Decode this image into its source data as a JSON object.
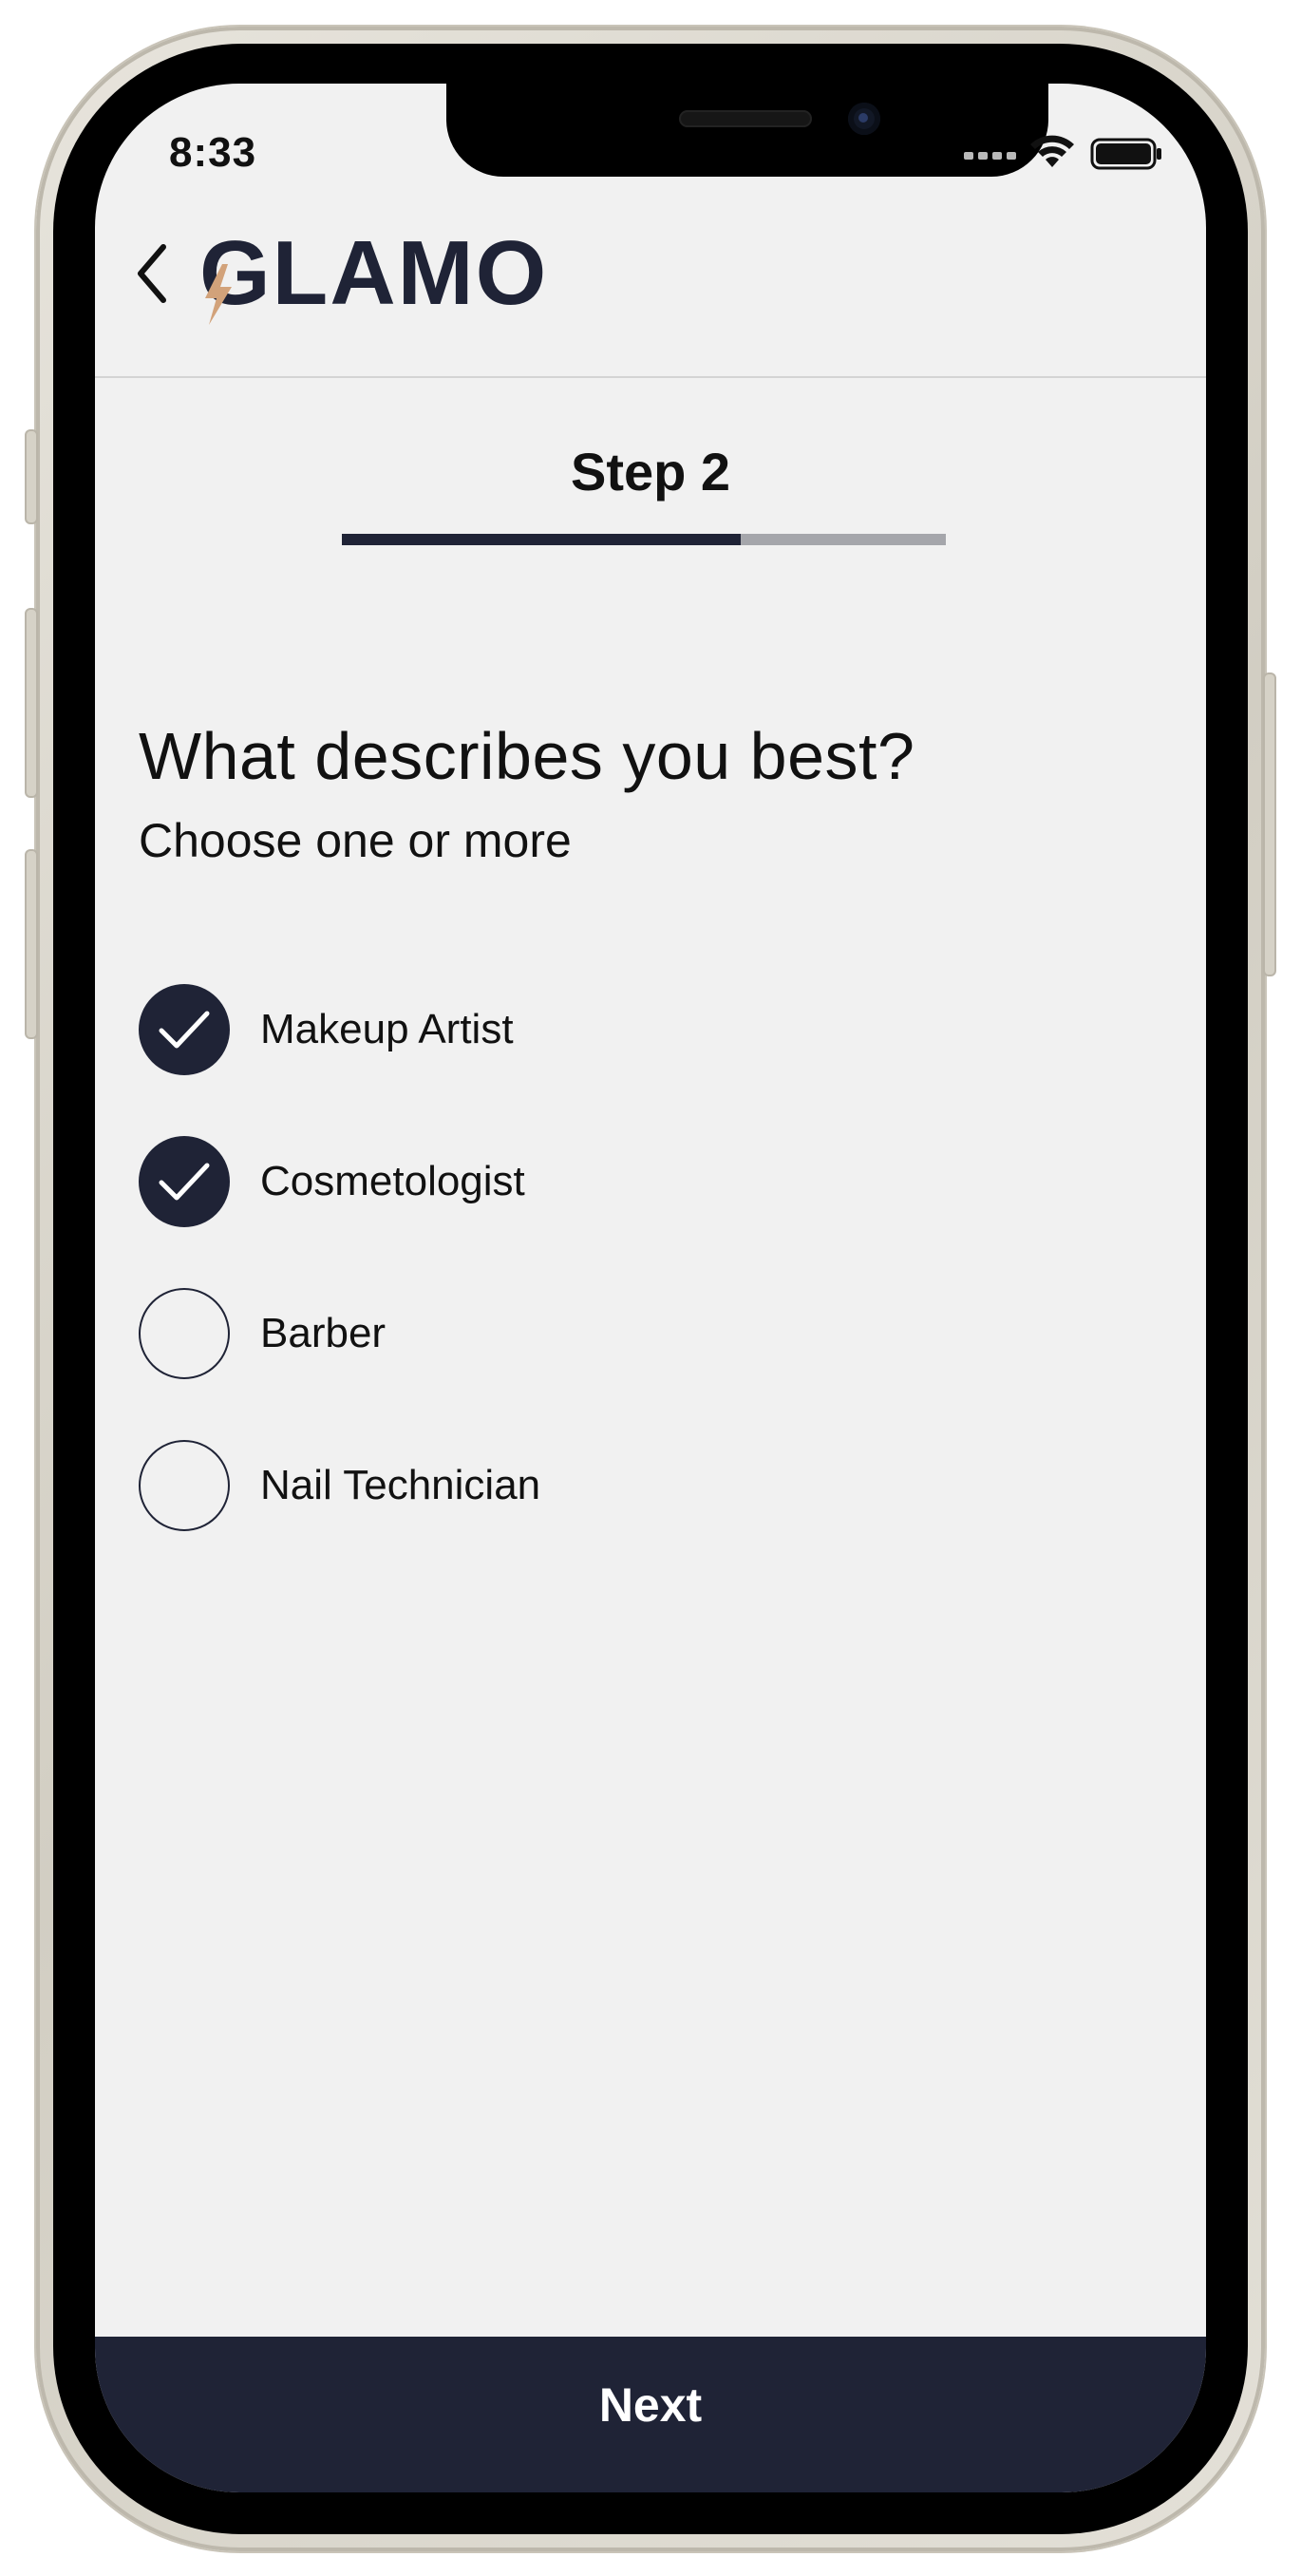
{
  "status_bar": {
    "time": "8:33"
  },
  "header": {
    "logo": "GLAMO"
  },
  "step": {
    "title": "Step 2",
    "progress": 0.66
  },
  "question": {
    "title": "What describes you best?",
    "subtitle": "Choose one or more"
  },
  "options": [
    {
      "label": "Makeup Artist",
      "checked": true
    },
    {
      "label": "Cosmetologist",
      "checked": true
    },
    {
      "label": "Barber",
      "checked": false
    },
    {
      "label": "Nail Technician",
      "checked": false
    }
  ],
  "footer": {
    "next_label": "Next"
  },
  "colors": {
    "primary": "#1f2336",
    "accent": "#d2a27a",
    "background": "#f1f1f1"
  }
}
